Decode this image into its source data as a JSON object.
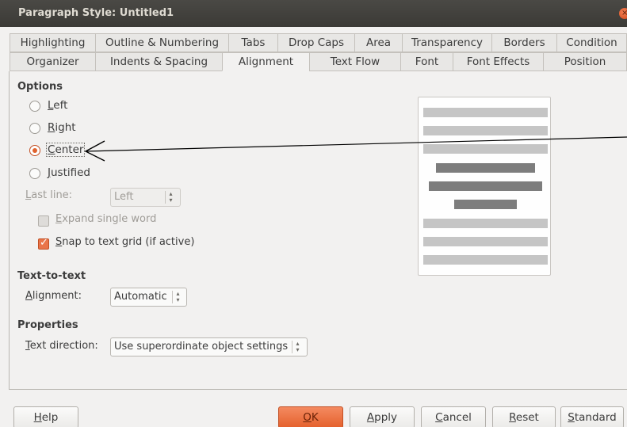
{
  "window": {
    "title": "Paragraph Style: Untitled1",
    "close_glyph": "×"
  },
  "tabs_row1": [
    {
      "label": "Highlighting"
    },
    {
      "label": "Outline & Numbering"
    },
    {
      "label": "Tabs"
    },
    {
      "label": "Drop Caps"
    },
    {
      "label": "Area"
    },
    {
      "label": "Transparency"
    },
    {
      "label": "Borders"
    },
    {
      "label": "Condition"
    }
  ],
  "tabs_row2": [
    {
      "label": "Organizer"
    },
    {
      "label": "Indents & Spacing"
    },
    {
      "label": "Alignment",
      "active": true
    },
    {
      "label": "Text Flow"
    },
    {
      "label": "Font"
    },
    {
      "label": "Font Effects"
    },
    {
      "label": "Position"
    }
  ],
  "options": {
    "title": "Options",
    "left": {
      "label": "eft",
      "mnemonic": "L",
      "checked": false
    },
    "right": {
      "label": "ight",
      "mnemonic": "R",
      "checked": false
    },
    "center": {
      "label": "enter",
      "mnemonic": "C",
      "checked": true
    },
    "justified": {
      "label": "ustified",
      "mnemonic": "J",
      "checked": false
    },
    "last_line": {
      "label": "ast line:",
      "mnemonic": "L",
      "value": "Left"
    },
    "expand_single_word": {
      "label": "xpand single word",
      "mnemonic": "E",
      "checked": false
    },
    "snap_to_grid": {
      "label": "nap to text grid (if active)",
      "mnemonic": "S",
      "checked": true
    }
  },
  "text_to_text": {
    "title": "Text-to-text",
    "alignment_label": "lignment:",
    "alignment_mnemonic": "A",
    "alignment_value": "Automatic"
  },
  "properties": {
    "title": "Properties",
    "text_direction_label": "ext direction:",
    "text_direction_mnemonic": "T",
    "text_direction_value": "Use superordinate object settings"
  },
  "buttons": {
    "help": {
      "mnemonic": "H",
      "rest": "elp"
    },
    "ok": {
      "mnemonic": "O",
      "rest": "K"
    },
    "apply": {
      "mnemonic": "A",
      "rest": "pply"
    },
    "cancel": {
      "mnemonic": "C",
      "rest": "ancel"
    },
    "reset": {
      "mnemonic": "R",
      "rest": "eset"
    },
    "standard": {
      "mnemonic": "S",
      "rest": "tandard"
    }
  },
  "colors": {
    "accent": "#e4602c",
    "titlebar": "#3e3d39"
  }
}
